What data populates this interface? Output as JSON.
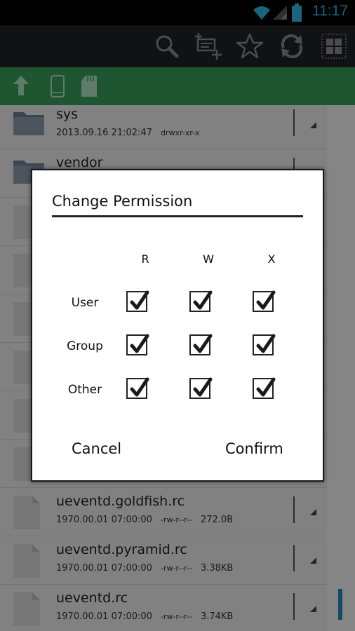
{
  "status_bar": {
    "time": "11:17"
  },
  "toolbar": {
    "icons": [
      "search-icon",
      "select-add-icon",
      "star-icon",
      "refresh-icon",
      "grid-view-icon"
    ]
  },
  "path_bar": {
    "icons": [
      "up-arrow-icon",
      "phone-storage-icon",
      "sd-card-icon"
    ]
  },
  "files": [
    {
      "name": "sys",
      "date": "2013.09.16 21:02:47",
      "perm": "drwxr-xr-x",
      "size": "",
      "type": "folder"
    },
    {
      "name": "vendor",
      "date": "",
      "perm": "",
      "size": "",
      "type": "folder"
    },
    {
      "name": "",
      "date": "",
      "perm": "",
      "size": "",
      "type": "file"
    },
    {
      "name": "",
      "date": "",
      "perm": "",
      "size": "",
      "type": "file"
    },
    {
      "name": "",
      "date": "",
      "perm": "",
      "size": "",
      "type": "file"
    },
    {
      "name": "",
      "date": "",
      "perm": "",
      "size": "",
      "type": "file"
    },
    {
      "name": "",
      "date": "",
      "perm": "",
      "size": "",
      "type": "file"
    },
    {
      "name": "",
      "date": "",
      "perm": "",
      "size": "",
      "type": "file"
    },
    {
      "name": "ueventd.goldfish.rc",
      "date": "1970.00.01 07:00:00",
      "perm": "-rw-r--r--",
      "size": "272.0B",
      "type": "file"
    },
    {
      "name": "ueventd.pyramid.rc",
      "date": "1970.00.01 07:00:00",
      "perm": "-rw-r--r--",
      "size": "3.38KB",
      "type": "file"
    },
    {
      "name": "ueventd.rc",
      "date": "1970.00.01 07:00:00",
      "perm": "-rw-r--r--",
      "size": "3.74KB",
      "type": "file"
    }
  ],
  "dialog": {
    "title": "Change Permission",
    "columns": [
      "R",
      "W",
      "X"
    ],
    "rows": [
      {
        "label": "User",
        "r": true,
        "w": true,
        "x": true
      },
      {
        "label": "Group",
        "r": true,
        "w": true,
        "x": true
      },
      {
        "label": "Other",
        "r": true,
        "w": true,
        "x": true
      }
    ],
    "cancel_label": "Cancel",
    "confirm_label": "Confirm"
  }
}
